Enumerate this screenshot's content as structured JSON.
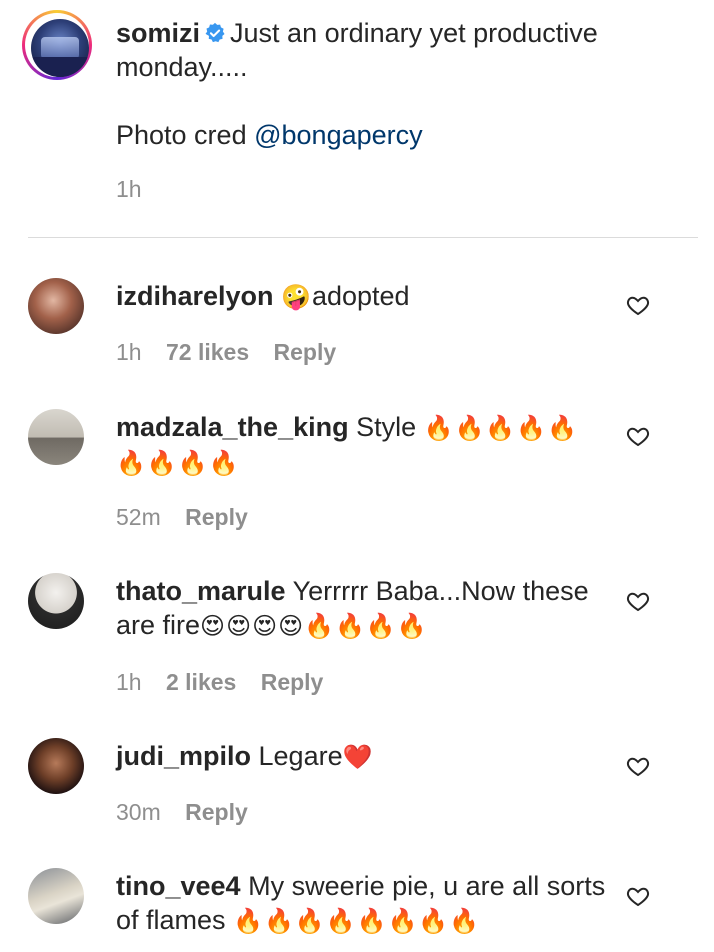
{
  "caption": {
    "username": "somizi",
    "text": "Just an ordinary yet productive monday.....",
    "credit_prefix": "Photo cred",
    "mention": "@bongapercy",
    "time": "1h"
  },
  "comments": [
    {
      "username": "izdiharelyon",
      "emoji_prefix": "🤪",
      "text": "adopted",
      "time": "1h",
      "likes": "72 likes",
      "reply": "Reply"
    },
    {
      "username": "madzala_the_king",
      "text": "Style",
      "emoji": "🔥🔥🔥🔥🔥🔥🔥🔥🔥",
      "time": "52m",
      "likes": "",
      "reply": "Reply"
    },
    {
      "username": "thato_marule",
      "text": "Yerrrrr Baba...Now these are fire",
      "emoji": "😍😍😍😍🔥🔥🔥🔥",
      "time": "1h",
      "likes": "2 likes",
      "reply": "Reply"
    },
    {
      "username": "judi_mpilo",
      "text": "Legare",
      "emoji": "❤️",
      "time": "30m",
      "likes": "",
      "reply": "Reply"
    },
    {
      "username": "tino_vee4",
      "text": "My sweerie pie, u are all sorts of flames",
      "emoji": "🔥🔥🔥🔥🔥🔥🔥🔥",
      "time": "",
      "likes": "",
      "reply": ""
    }
  ],
  "colors": {
    "text": "#262626",
    "muted": "#8e8e8e",
    "link": "#00376b",
    "verified": "#3897f0",
    "divider": "#dbdbdb"
  },
  "icons": {
    "verified": "verified-badge-icon",
    "like": "heart-outline-icon"
  }
}
